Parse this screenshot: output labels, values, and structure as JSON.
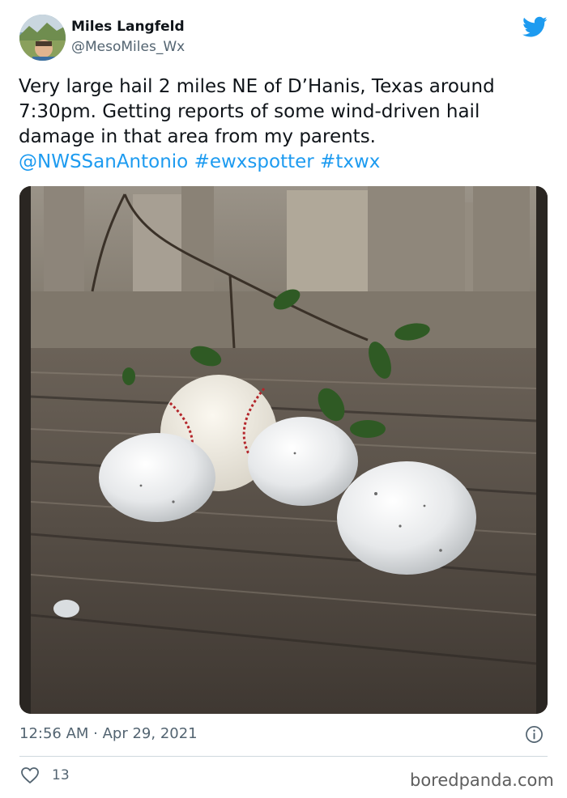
{
  "author": {
    "display_name": "Miles Langfeld",
    "handle": "@MesoMiles_Wx"
  },
  "tweet": {
    "lines": [
      "Very large hail 2 miles NE of D’Hanis, Texas around",
      "7:30pm. Getting reports of some wind-driven hail",
      "damage in that area from my parents."
    ],
    "links": {
      "mention": "@NWSSanAntonio",
      "hashtag1": "#ewxspotter",
      "hashtag2": "#txwx"
    }
  },
  "meta": {
    "timestamp": "12:56 AM · Apr 29, 2021",
    "like_count": "13"
  },
  "watermark": "boredpanda.com",
  "icons": {
    "brand": "twitter-bird-icon",
    "info": "info-icon",
    "like": "heart-icon"
  },
  "colors": {
    "brand_blue": "#1d9bf0",
    "secondary_text": "#536471",
    "divider": "#cfd9de"
  }
}
